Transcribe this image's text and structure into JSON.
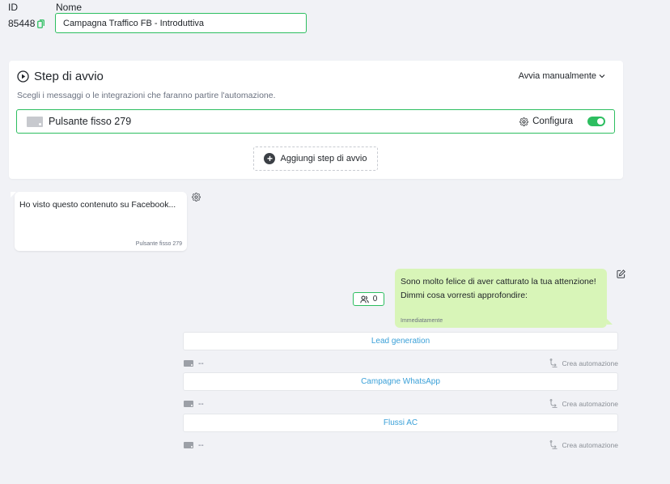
{
  "header": {
    "id_label": "ID",
    "id_value": "85448",
    "name_label": "Nome",
    "name_value": "Campagna Traffico FB - Introduttiva"
  },
  "start_card": {
    "title": "Step di avvio",
    "subtitle": "Scegli i messaggi o le integrazioni che faranno partire l'automazione.",
    "start_mode": "Avvia manualmente",
    "trigger": {
      "label": "Pulsante fisso 279",
      "configure_label": "Configura",
      "enabled": true
    },
    "add_step_label": "Aggiungi step di avvio"
  },
  "incoming_message": {
    "text": "Ho visto questo contenuto su Facebook...",
    "footer": "Pulsante fisso 279"
  },
  "reply": {
    "readers_count": "0",
    "line1": "Sono molto felice di aver catturato la tua attenzione!",
    "line2": "Dimmi cosa vorresti approfondire:",
    "timing": "Immediatamente"
  },
  "options": [
    {
      "label": "Lead generation",
      "placeholder": "--",
      "action": "Crea automazione"
    },
    {
      "label": "Campagne WhatsApp",
      "placeholder": "--",
      "action": "Crea automazione"
    },
    {
      "label": "Flussi AC",
      "placeholder": "--",
      "action": "Crea automazione"
    }
  ],
  "colors": {
    "accent_green": "#2dbe60",
    "link_blue": "#3aa0d8",
    "reply_bubble": "#d8f5b8",
    "background": "#f1f2f6"
  }
}
